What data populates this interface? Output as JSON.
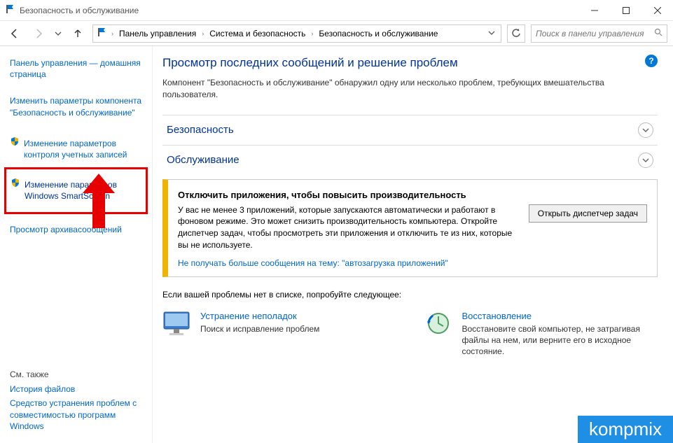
{
  "window": {
    "title": "Безопасность и обслуживание"
  },
  "breadcrumb": {
    "items": [
      "Панель управления",
      "Система и безопасность",
      "Безопасность и обслуживание"
    ]
  },
  "search": {
    "placeholder": "Поиск в панели управления"
  },
  "sidebar": {
    "home": "Панель управления — домашняя страница",
    "change_settings": "Изменить параметры компонента \"Безопасность и обслуживание\"",
    "uac": "Изменение параметров контроля учетных записей",
    "smartscreen": "Изменение параметров Windows SmartScreen",
    "archive": "Просмотр архивасообщений",
    "see_also_label": "См. также",
    "file_history": "История файлов",
    "compat": "Средство устранения проблем с совместимостью программ Windows"
  },
  "main": {
    "heading": "Просмотр последних сообщений и решение проблем",
    "subtext": "Компонент \"Безопасность и обслуживание\" обнаружил одну или несколько проблем, требующих вмешательства пользователя.",
    "security_label": "Безопасность",
    "maintenance_label": "Обслуживание",
    "alert": {
      "title": "Отключить приложения, чтобы повысить производительность",
      "body": "У вас не менее 3 приложений, которые запускаются автоматически и работают в фоновом режиме. Это может снизить производительность компьютера. Откройте диспетчер задач, чтобы просмотреть эти приложения и отключить те из них, которые вы не используете.",
      "button": "Открыть диспетчер задач",
      "link": "Не получать больше сообщения на тему: \"автозагрузка приложений\""
    },
    "other_problems": "Если вашей проблемы нет в списке, попробуйте следующее:",
    "tile1": {
      "title": "Устранение неполадок",
      "desc": "Поиск и исправление проблем"
    },
    "tile2": {
      "title": "Восстановление",
      "desc": "Восстановите свой компьютер, не затрагивая файлы на нем, или верните его в исходное состояние."
    }
  },
  "watermark": "kompmix"
}
